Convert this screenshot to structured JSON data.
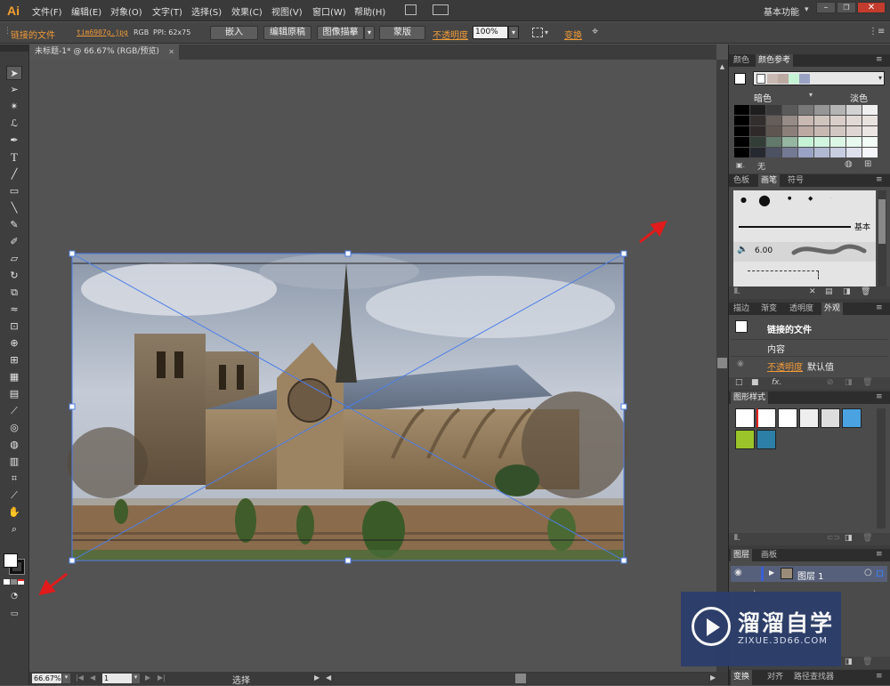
{
  "app": {
    "logo": "Ai",
    "workspace": "基本功能"
  },
  "menu": [
    "文件(F)",
    "编辑(E)",
    "对象(O)",
    "文字(T)",
    "选择(S)",
    "效果(C)",
    "视图(V)",
    "窗口(W)",
    "帮助(H)"
  ],
  "control": {
    "linked_file": "链接的文件",
    "filename": "tim6907g.jpg",
    "color_mode": "RGB",
    "ppi": "PPI: 62x75",
    "embed": "嵌入",
    "edit_original": "编辑原稿",
    "image_trace": "图像描摹",
    "mask": "蒙版",
    "opacity_label": "不透明度",
    "opacity_value": "100%",
    "transform": "变换"
  },
  "document": {
    "tab_title": "未标题-1* @ 66.67% (RGB/预览)"
  },
  "status": {
    "zoom": "66.67%",
    "page": "1",
    "mode": "选择"
  },
  "panels": {
    "color_tabs": [
      "颜色",
      "颜色参考"
    ],
    "guide_dark": "暗色",
    "guide_light": "淡色",
    "guide_none": "无",
    "brush_tabs": [
      "色板",
      "画笔",
      "符号"
    ],
    "brush_basic": "基本",
    "brush_size": "6.00",
    "appearance_tabs": [
      "描边",
      "渐变",
      "透明度",
      "外观"
    ],
    "appearance_title": "链接的文件",
    "appearance_content": "内容",
    "appearance_opacity": "不透明度",
    "appearance_opacity_value": "默认值",
    "graphic_styles_tab": "图形样式",
    "layers_tabs": [
      "图层",
      "画板"
    ],
    "layer_name": "图层 1",
    "bottom_tabs": [
      "变换",
      "对齐",
      "路径查找器"
    ]
  },
  "watermark": {
    "title": "溜溜自学",
    "url": "ZIXUE.3D66.COM"
  },
  "colors": {
    "accent_orange": "#f19a38",
    "panel_bg": "#4b4b4b",
    "selection_blue": "#4d7ee8",
    "arrow_red": "#e11b1b"
  },
  "icons": [
    "selection-tool-icon",
    "direct-selection-icon",
    "magic-wand-icon",
    "lasso-icon",
    "pen-icon",
    "type-icon",
    "line-icon",
    "rectangle-icon",
    "paintbrush-icon",
    "pencil-icon",
    "blob-brush-icon",
    "eraser-icon",
    "rotate-icon",
    "scale-icon",
    "warp-icon",
    "free-transform-icon",
    "shape-builder-icon",
    "perspective-icon",
    "mesh-icon",
    "gradient-icon",
    "eyedropper-icon",
    "blend-icon",
    "symbol-sprayer-icon",
    "column-graph-icon",
    "artboard-icon",
    "slice-icon",
    "hand-icon",
    "zoom-icon"
  ]
}
